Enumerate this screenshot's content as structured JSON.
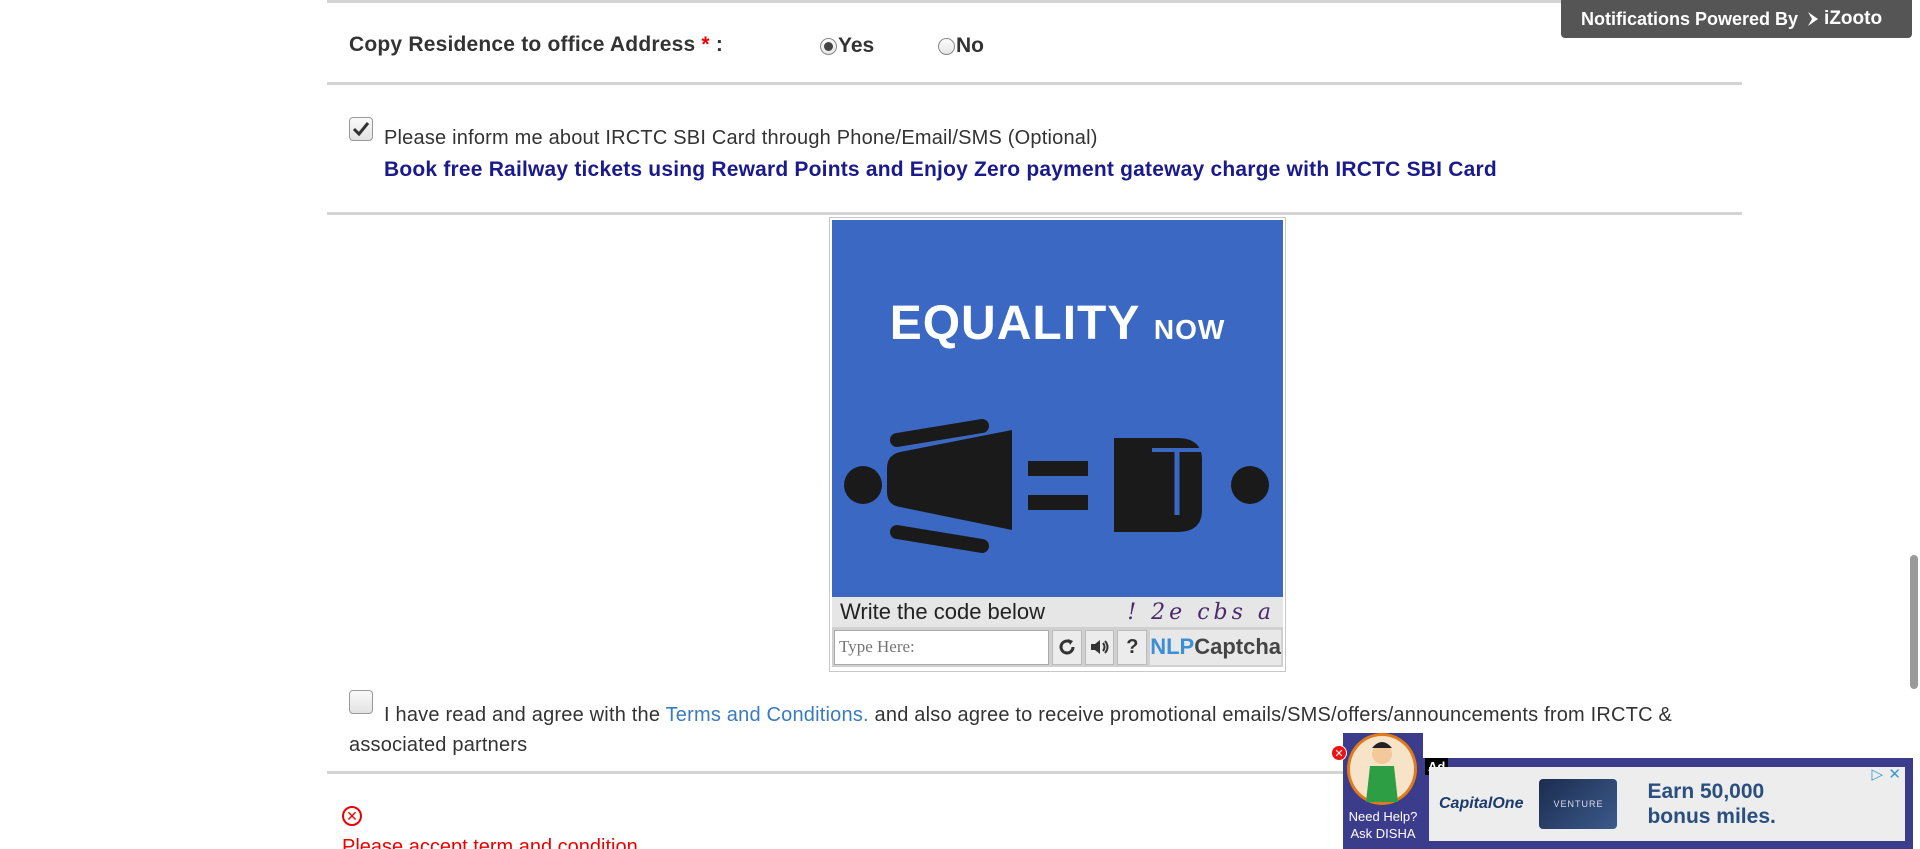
{
  "notification": {
    "text": "Notifications Powered By",
    "brand": "iZooto"
  },
  "address": {
    "label": "Copy Residence to office Address",
    "required_mark": "*",
    "colon": ":",
    "options": [
      {
        "label": "Yes",
        "selected": true
      },
      {
        "label": "No",
        "selected": false
      }
    ]
  },
  "sbi": {
    "checked": true,
    "text": "Please inform me about IRCTC SBI Card through Phone/Email/SMS (Optional)",
    "promo": "Book free Railway tickets using Reward Points and Enjoy Zero payment gateway charge with IRCTC SBI Card"
  },
  "captcha": {
    "ad_title": "EQUALITY",
    "ad_title_small": "NOW",
    "instruction": "Write the code below",
    "code": "! 2e cbs a",
    "placeholder": "Type Here:",
    "logo_a": "NLP",
    "logo_b": "Captcha",
    "refresh_icon": "refresh-icon",
    "audio_icon": "speaker-icon",
    "help_icon": "help-icon",
    "help_symbol": "?"
  },
  "terms": {
    "checked": false,
    "before": "I have read and agree with the",
    "link": "Terms and Conditions.",
    "after": "and also agree to receive promotional emails/SMS/offers/announcements from IRCTC & associated partners"
  },
  "error": {
    "text": "Please accept term and condition",
    "icon": "error-circle-icon"
  },
  "disha": {
    "line1": "Need Help?",
    "line2": "Ask DISHA"
  },
  "ad": {
    "label": "Ad",
    "advertiser": "CapitalOne",
    "card_text": "VENTURE",
    "offer_line1": "Earn 50,000",
    "offer_line2": "bonus miles."
  },
  "colors": {
    "accent_blue": "#3a68c2",
    "promo_navy": "#1a1a8c",
    "error_red": "#e00000",
    "link_blue": "#3a7bbf"
  }
}
